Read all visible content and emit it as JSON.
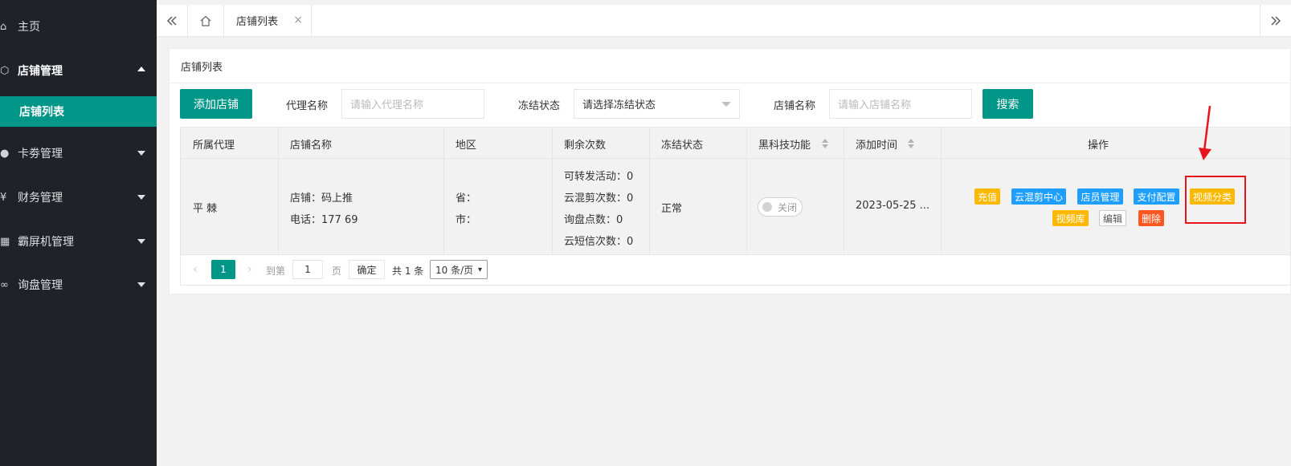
{
  "sidebar": {
    "items": [
      {
        "label": "主页",
        "icon": "home-icon",
        "glyph": "⌂"
      },
      {
        "label": "店铺管理",
        "icon": "cube-icon",
        "glyph": "⬡",
        "expanded": true
      },
      {
        "label": "卡劵管理",
        "icon": "circle-icon",
        "glyph": "●"
      },
      {
        "label": "财务管理",
        "icon": "yen-icon",
        "glyph": "¥"
      },
      {
        "label": "霸屏机管理",
        "icon": "grid-icon",
        "glyph": "▦"
      },
      {
        "label": "询盘管理",
        "icon": "link-icon",
        "glyph": "∞"
      }
    ],
    "sub_active": "店铺列表"
  },
  "tabbar": {
    "active_tab": "店铺列表",
    "close_glyph": "×"
  },
  "card": {
    "title": "店铺列表"
  },
  "filters": {
    "add_button": "添加店铺",
    "agent_label": "代理名称",
    "agent_placeholder": "请输入代理名称",
    "freeze_label": "冻结状态",
    "freeze_selected": "请选择冻结状态",
    "shop_label": "店铺名称",
    "shop_placeholder": "请输入店铺名称",
    "search_button": "搜索"
  },
  "table": {
    "headers": [
      "所属代理",
      "店铺名称",
      "地区",
      "剩余次数",
      "冻结状态",
      "黑科技功能",
      "添加时间",
      "操作"
    ],
    "row": {
      "agent": "平 棘",
      "shop_line": "店铺：码上推",
      "phone_line": "电话：177          69",
      "province": "省：",
      "city": "市：",
      "counts": [
        "可转发活动：0",
        "云混剪次数：0",
        "询盘点数：0",
        "云短信次数：0"
      ],
      "freeze_status": "正常",
      "switch_label": "关闭",
      "add_time": "2023-05-25 ...",
      "actions": [
        "充值",
        "云混剪中心",
        "店员管理",
        "支付配置",
        "视频分类",
        "视频库",
        "编辑",
        "删除"
      ]
    }
  },
  "pager": {
    "prev": "‹",
    "current": "1",
    "next": "›",
    "goto": "到第",
    "page_value": "1",
    "page_unit": "页",
    "confirm": "确定",
    "total": "共 1 条",
    "page_size": "10 条/页"
  },
  "colors": {
    "accent": "#009688",
    "sidebar_bg": "#20222a",
    "yellow": "#ffb800",
    "blue": "#1e9fff",
    "red": "#ff5722",
    "highlight": "#e8141b"
  }
}
